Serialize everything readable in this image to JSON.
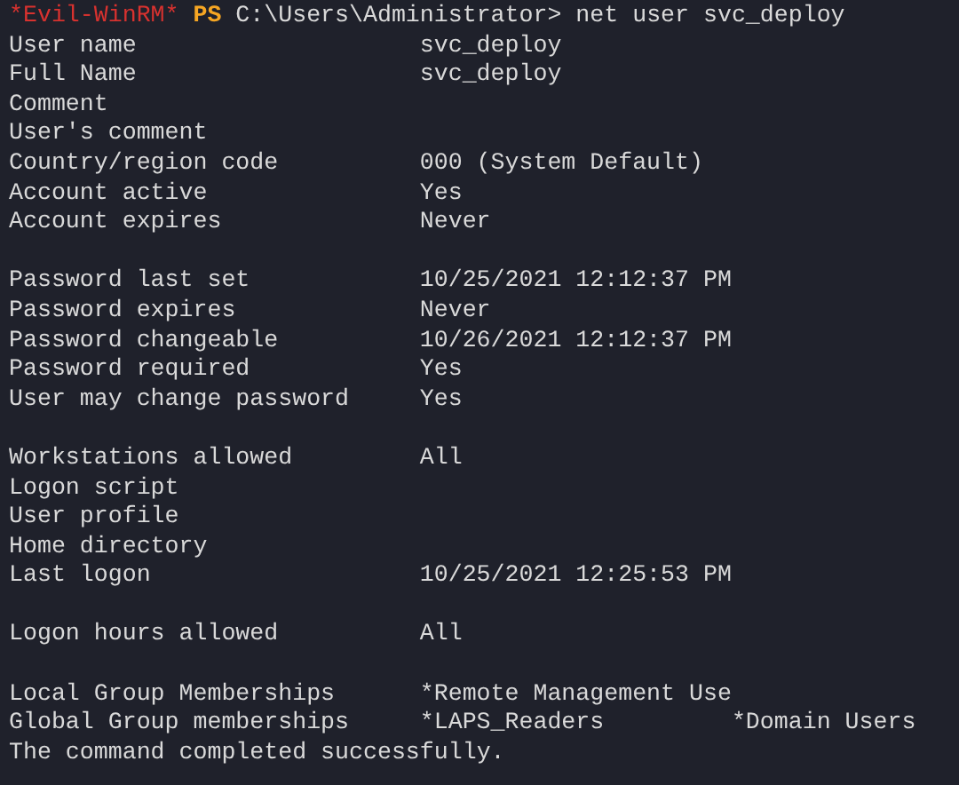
{
  "prompt": {
    "shell_tag": "*Evil-WinRM*",
    "ps": "PS",
    "command": "C:\\Users\\Administrator> net user svc_deploy"
  },
  "groups": [
    {
      "rows": [
        {
          "label": "User name",
          "values": [
            "svc_deploy"
          ]
        },
        {
          "label": "Full Name",
          "values": [
            "svc_deploy"
          ]
        },
        {
          "label": "Comment",
          "values": []
        },
        {
          "label": "User's comment",
          "values": []
        },
        {
          "label": "Country/region code",
          "values": [
            "000 (System Default)"
          ]
        },
        {
          "label": "Account active",
          "values": [
            "Yes"
          ]
        },
        {
          "label": "Account expires",
          "values": [
            "Never"
          ]
        }
      ]
    },
    {
      "rows": [
        {
          "label": "Password last set",
          "values": [
            "10/25/2021 12:12:37 PM"
          ]
        },
        {
          "label": "Password expires",
          "values": [
            "Never"
          ]
        },
        {
          "label": "Password changeable",
          "values": [
            "10/26/2021 12:12:37 PM"
          ]
        },
        {
          "label": "Password required",
          "values": [
            "Yes"
          ]
        },
        {
          "label": "User may change password",
          "values": [
            "Yes"
          ]
        }
      ]
    },
    {
      "rows": [
        {
          "label": "Workstations allowed",
          "values": [
            "All"
          ]
        },
        {
          "label": "Logon script",
          "values": []
        },
        {
          "label": "User profile",
          "values": []
        },
        {
          "label": "Home directory",
          "values": []
        },
        {
          "label": "Last logon",
          "values": [
            "10/25/2021 12:25:53 PM"
          ]
        }
      ]
    },
    {
      "rows": [
        {
          "label": "Logon hours allowed",
          "values": [
            "All"
          ]
        }
      ]
    },
    {
      "rows": [
        {
          "label": "Local Group Memberships",
          "values": [
            "*Remote Management Use"
          ]
        },
        {
          "label": "Global Group memberships",
          "values": [
            "*LAPS_Readers",
            "*Domain Users"
          ]
        }
      ]
    }
  ],
  "result": "The command completed successfully."
}
